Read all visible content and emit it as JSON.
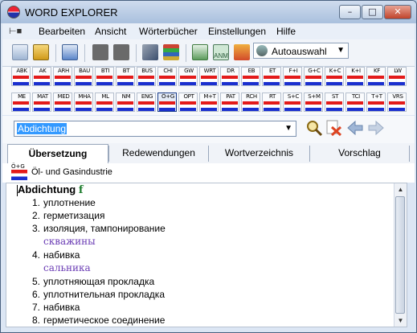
{
  "window": {
    "title": "WORD EXPLORER"
  },
  "menu": {
    "items": [
      "Bearbeiten",
      "Ansicht",
      "Wörterbücher",
      "Einstellungen",
      "Hilfe"
    ]
  },
  "toolbar": {
    "auto_select_label": "Autoauswahl"
  },
  "dictionaries": {
    "row1": [
      "ABK",
      "AK",
      "ARH",
      "BAU",
      "BTI",
      "BT",
      "BUS",
      "CHI",
      "GW",
      "WRT",
      "DR",
      "EB",
      "ET",
      "F+I",
      "G+C",
      "K+C",
      "K+I",
      "KF",
      "LW"
    ],
    "row2": [
      "ME",
      "MAT",
      "MED",
      "MHA",
      "ML",
      "NM",
      "ENG",
      "Ö+G",
      "OPT",
      "M+T",
      "PAT",
      "RCH",
      "RT",
      "S+C",
      "S+M",
      "ST",
      "TCI",
      "T+T",
      "VRS"
    ],
    "active": "Ö+G"
  },
  "search": {
    "value": "Abdichtung"
  },
  "tabs": [
    "Übersetzung",
    "Redewendungen",
    "Wortverzeichnis",
    "Vorschlag"
  ],
  "subject": {
    "code": "Ö+G",
    "label": "Öl- und Gasindustrie"
  },
  "entry": {
    "headword": "Abdichtung",
    "gender": "f",
    "senses": [
      {
        "num": "1.",
        "text": "уплотнение"
      },
      {
        "num": "2.",
        "text": "герметизация"
      },
      {
        "num": "3.",
        "text": "изоляция, тампонирование",
        "note": "скважины"
      },
      {
        "num": "4.",
        "text": "набивка",
        "note": "сальника"
      },
      {
        "num": "5.",
        "text": "уплотняющая прокладка"
      },
      {
        "num": "6.",
        "text": "уплотнительная прокладка"
      },
      {
        "num": "7.",
        "text": "набивка"
      },
      {
        "num": "8.",
        "text": "герметическое соединение"
      }
    ]
  }
}
